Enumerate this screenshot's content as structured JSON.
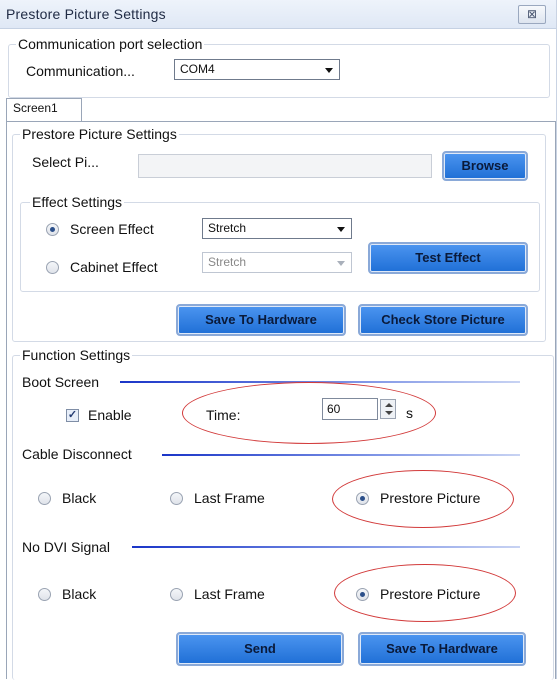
{
  "window": {
    "title": "Prestore Picture Settings",
    "close_glyph": "⊠"
  },
  "comm": {
    "group_title": "Communication port selection",
    "label": "Communication...",
    "port_value": "COM4"
  },
  "tabs": [
    {
      "label": "Screen1"
    }
  ],
  "prestore": {
    "group_title": "Prestore Picture Settings",
    "select_label": "Select Pi...",
    "browse_label": "Browse",
    "effect": {
      "group_title": "Effect Settings",
      "screen_effect_label": "Screen Effect",
      "screen_effect_value": "Stretch",
      "cabinet_effect_label": "Cabinet Effect",
      "cabinet_effect_value": "Stretch",
      "test_label": "Test Effect"
    },
    "save_label": "Save To Hardware",
    "check_label": "Check Store Picture"
  },
  "function": {
    "group_title": "Function Settings",
    "boot": {
      "title": "Boot Screen",
      "enable_label": "Enable",
      "enable_checked": true,
      "time_label": "Time:",
      "time_value": "60",
      "unit": "s"
    },
    "cable": {
      "title": "Cable Disconnect",
      "options": [
        "Black",
        "Last Frame",
        "Prestore Picture"
      ],
      "selected": "Prestore Picture"
    },
    "nodvi": {
      "title": "No DVI Signal",
      "options": [
        "Black",
        "Last Frame",
        "Prestore Picture"
      ],
      "selected": "Prestore Picture"
    },
    "send_label": "Send",
    "save_label": "Save To Hardware"
  },
  "colors": {
    "button_blue": "#1f6fd6",
    "separator_blue": "#1a35c8",
    "annotation_red": "#d23a3a"
  }
}
